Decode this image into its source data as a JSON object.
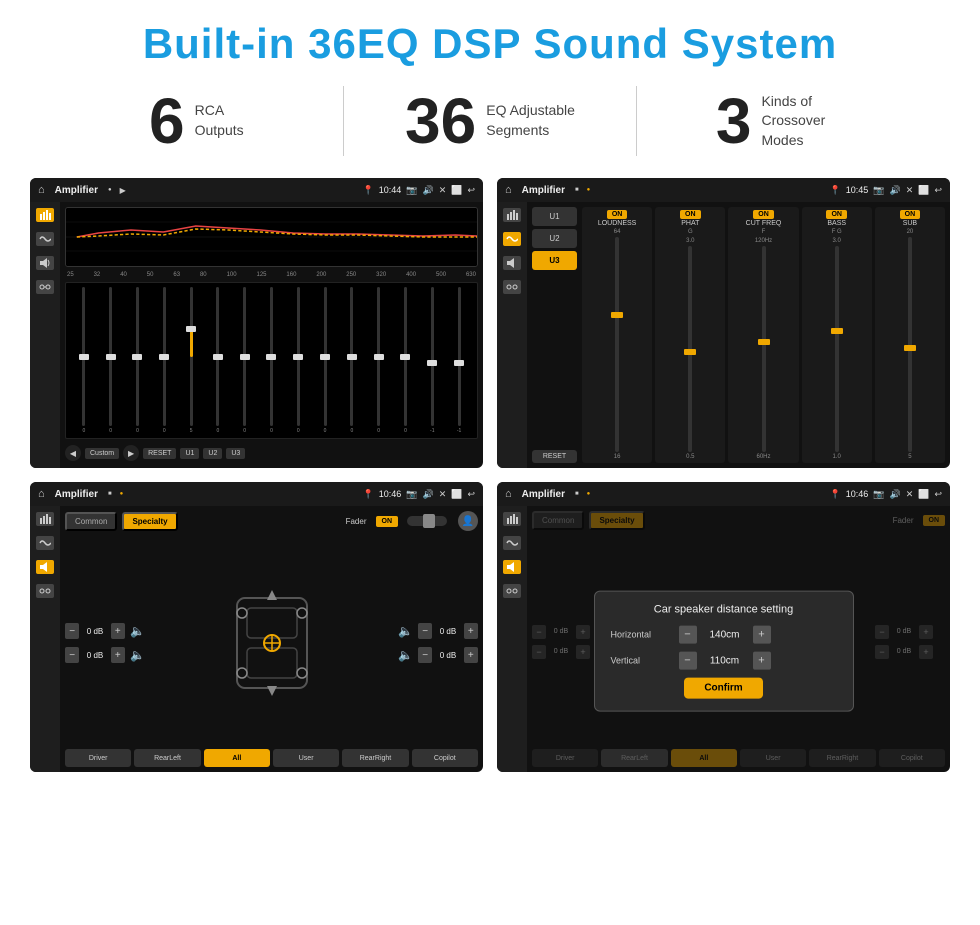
{
  "header": {
    "title": "Built-in 36EQ DSP Sound System"
  },
  "stats": [
    {
      "number": "6",
      "label_line1": "RCA",
      "label_line2": "Outputs"
    },
    {
      "number": "36",
      "label_line1": "EQ Adjustable",
      "label_line2": "Segments"
    },
    {
      "number": "3",
      "label_line1": "Kinds of",
      "label_line2": "Crossover Modes"
    }
  ],
  "screens": [
    {
      "id": "screen1",
      "topbar": {
        "title": "Amplifier",
        "time": "10:44"
      },
      "type": "eq"
    },
    {
      "id": "screen2",
      "topbar": {
        "title": "Amplifier",
        "time": "10:45"
      },
      "type": "crossover"
    },
    {
      "id": "screen3",
      "topbar": {
        "title": "Amplifier",
        "time": "10:46"
      },
      "type": "fader"
    },
    {
      "id": "screen4",
      "topbar": {
        "title": "Amplifier",
        "time": "10:46"
      },
      "type": "fader-dialog"
    }
  ],
  "eq": {
    "frequencies": [
      "25",
      "32",
      "40",
      "50",
      "63",
      "80",
      "100",
      "125",
      "160",
      "200",
      "250",
      "320",
      "400",
      "500",
      "630"
    ],
    "values": [
      0,
      0,
      0,
      0,
      5,
      0,
      0,
      0,
      0,
      0,
      0,
      0,
      0,
      -1,
      -1
    ],
    "buttons": [
      "Custom",
      "RESET",
      "U1",
      "U2",
      "U3"
    ]
  },
  "crossover": {
    "presets": [
      "U1",
      "U2",
      "U3"
    ],
    "channels": [
      {
        "label": "LOUDNESS",
        "on": true,
        "type": ""
      },
      {
        "label": "PHAT",
        "on": true,
        "type": "G"
      },
      {
        "label": "CUT FREQ",
        "on": true,
        "type": "F"
      },
      {
        "label": "BASS",
        "on": true,
        "type": "F G"
      },
      {
        "label": "SUB",
        "on": true,
        "type": ""
      }
    ],
    "reset_label": "RESET"
  },
  "fader": {
    "tabs": [
      "Common",
      "Specialty"
    ],
    "active_tab": "Specialty",
    "fader_label": "Fader",
    "on_label": "ON",
    "left_controls": [
      "0 dB",
      "0 dB"
    ],
    "right_controls": [
      "0 dB",
      "0 dB"
    ],
    "bottom_buttons": [
      "Driver",
      "RearLeft",
      "All",
      "User",
      "RearRight",
      "Copilot"
    ],
    "active_bottom": "All"
  },
  "dialog": {
    "title": "Car speaker distance setting",
    "rows": [
      {
        "label": "Horizontal",
        "value": "140cm"
      },
      {
        "label": "Vertical",
        "value": "110cm"
      }
    ],
    "confirm_label": "Confirm"
  }
}
